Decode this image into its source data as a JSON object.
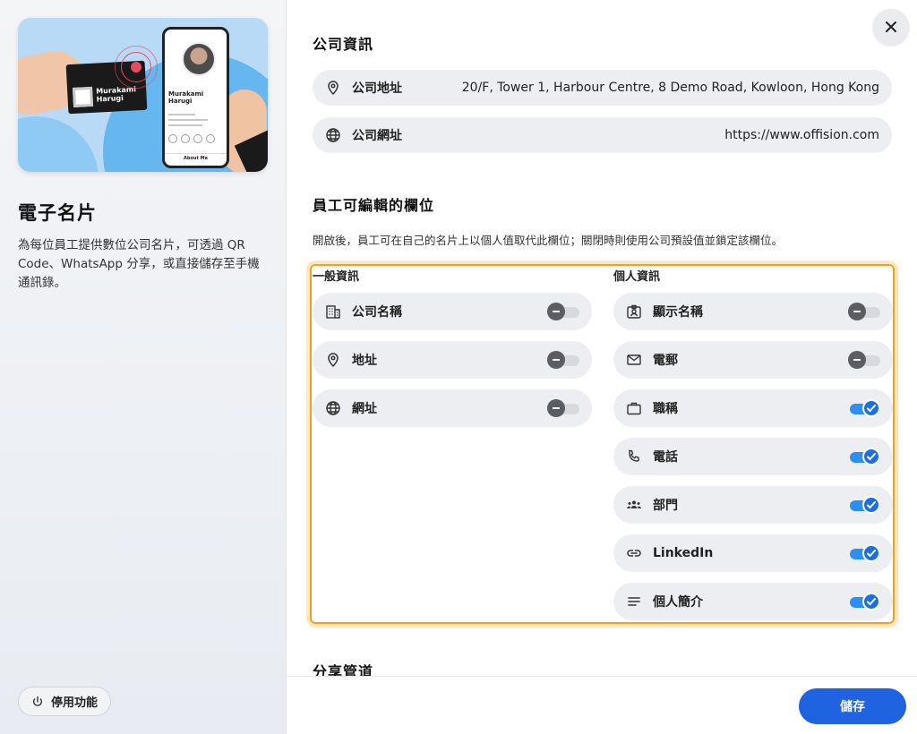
{
  "left": {
    "title": "電子名片",
    "description": "為每位員工提供數位公司名片，可透過 QR Code、WhatsApp 分享，或直接儲存至手機通訊錄。",
    "disable_label": "停用功能",
    "hero": {
      "card_name": "Murakami Harugi",
      "phone_name": "Murakami Harugi",
      "about": "About Me"
    }
  },
  "company": {
    "title": "公司資訊",
    "address_label": "公司地址",
    "address_value": "20/F, Tower 1, Harbour Centre, 8 Demo Road, Kowloon, Hong Kong",
    "website_label": "公司網址",
    "website_value": "https://www.offision.com"
  },
  "editable": {
    "title": "員工可編輯的欄位",
    "hint": "開啟後，員工可在自己的名片上以個人值取代此欄位；關閉時則使用公司預設值並鎖定該欄位。",
    "general_title": "一般資訊",
    "personal_title": "個人資訊",
    "general": [
      {
        "label": "公司名稱",
        "icon": "building-icon",
        "on": false
      },
      {
        "label": "地址",
        "icon": "location-pin-icon",
        "on": false
      },
      {
        "label": "網址",
        "icon": "globe-icon",
        "on": false
      }
    ],
    "personal": [
      {
        "label": "顯示名稱",
        "icon": "id-badge-icon",
        "on": false
      },
      {
        "label": "電郵",
        "icon": "mail-icon",
        "on": false
      },
      {
        "label": "職稱",
        "icon": "briefcase-icon",
        "on": true
      },
      {
        "label": "電話",
        "icon": "phone-icon",
        "on": true
      },
      {
        "label": "部門",
        "icon": "group-icon",
        "on": true
      },
      {
        "label": "LinkedIn",
        "icon": "link-icon",
        "on": true
      },
      {
        "label": "個人簡介",
        "icon": "lines-icon",
        "on": true
      }
    ]
  },
  "share": {
    "title": "分享管道"
  },
  "footer": {
    "save_label": "儲存"
  },
  "colors": {
    "accent": "#1f63e0",
    "highlight": "#f0a21e",
    "toggle_on": "#2e8ff0"
  }
}
